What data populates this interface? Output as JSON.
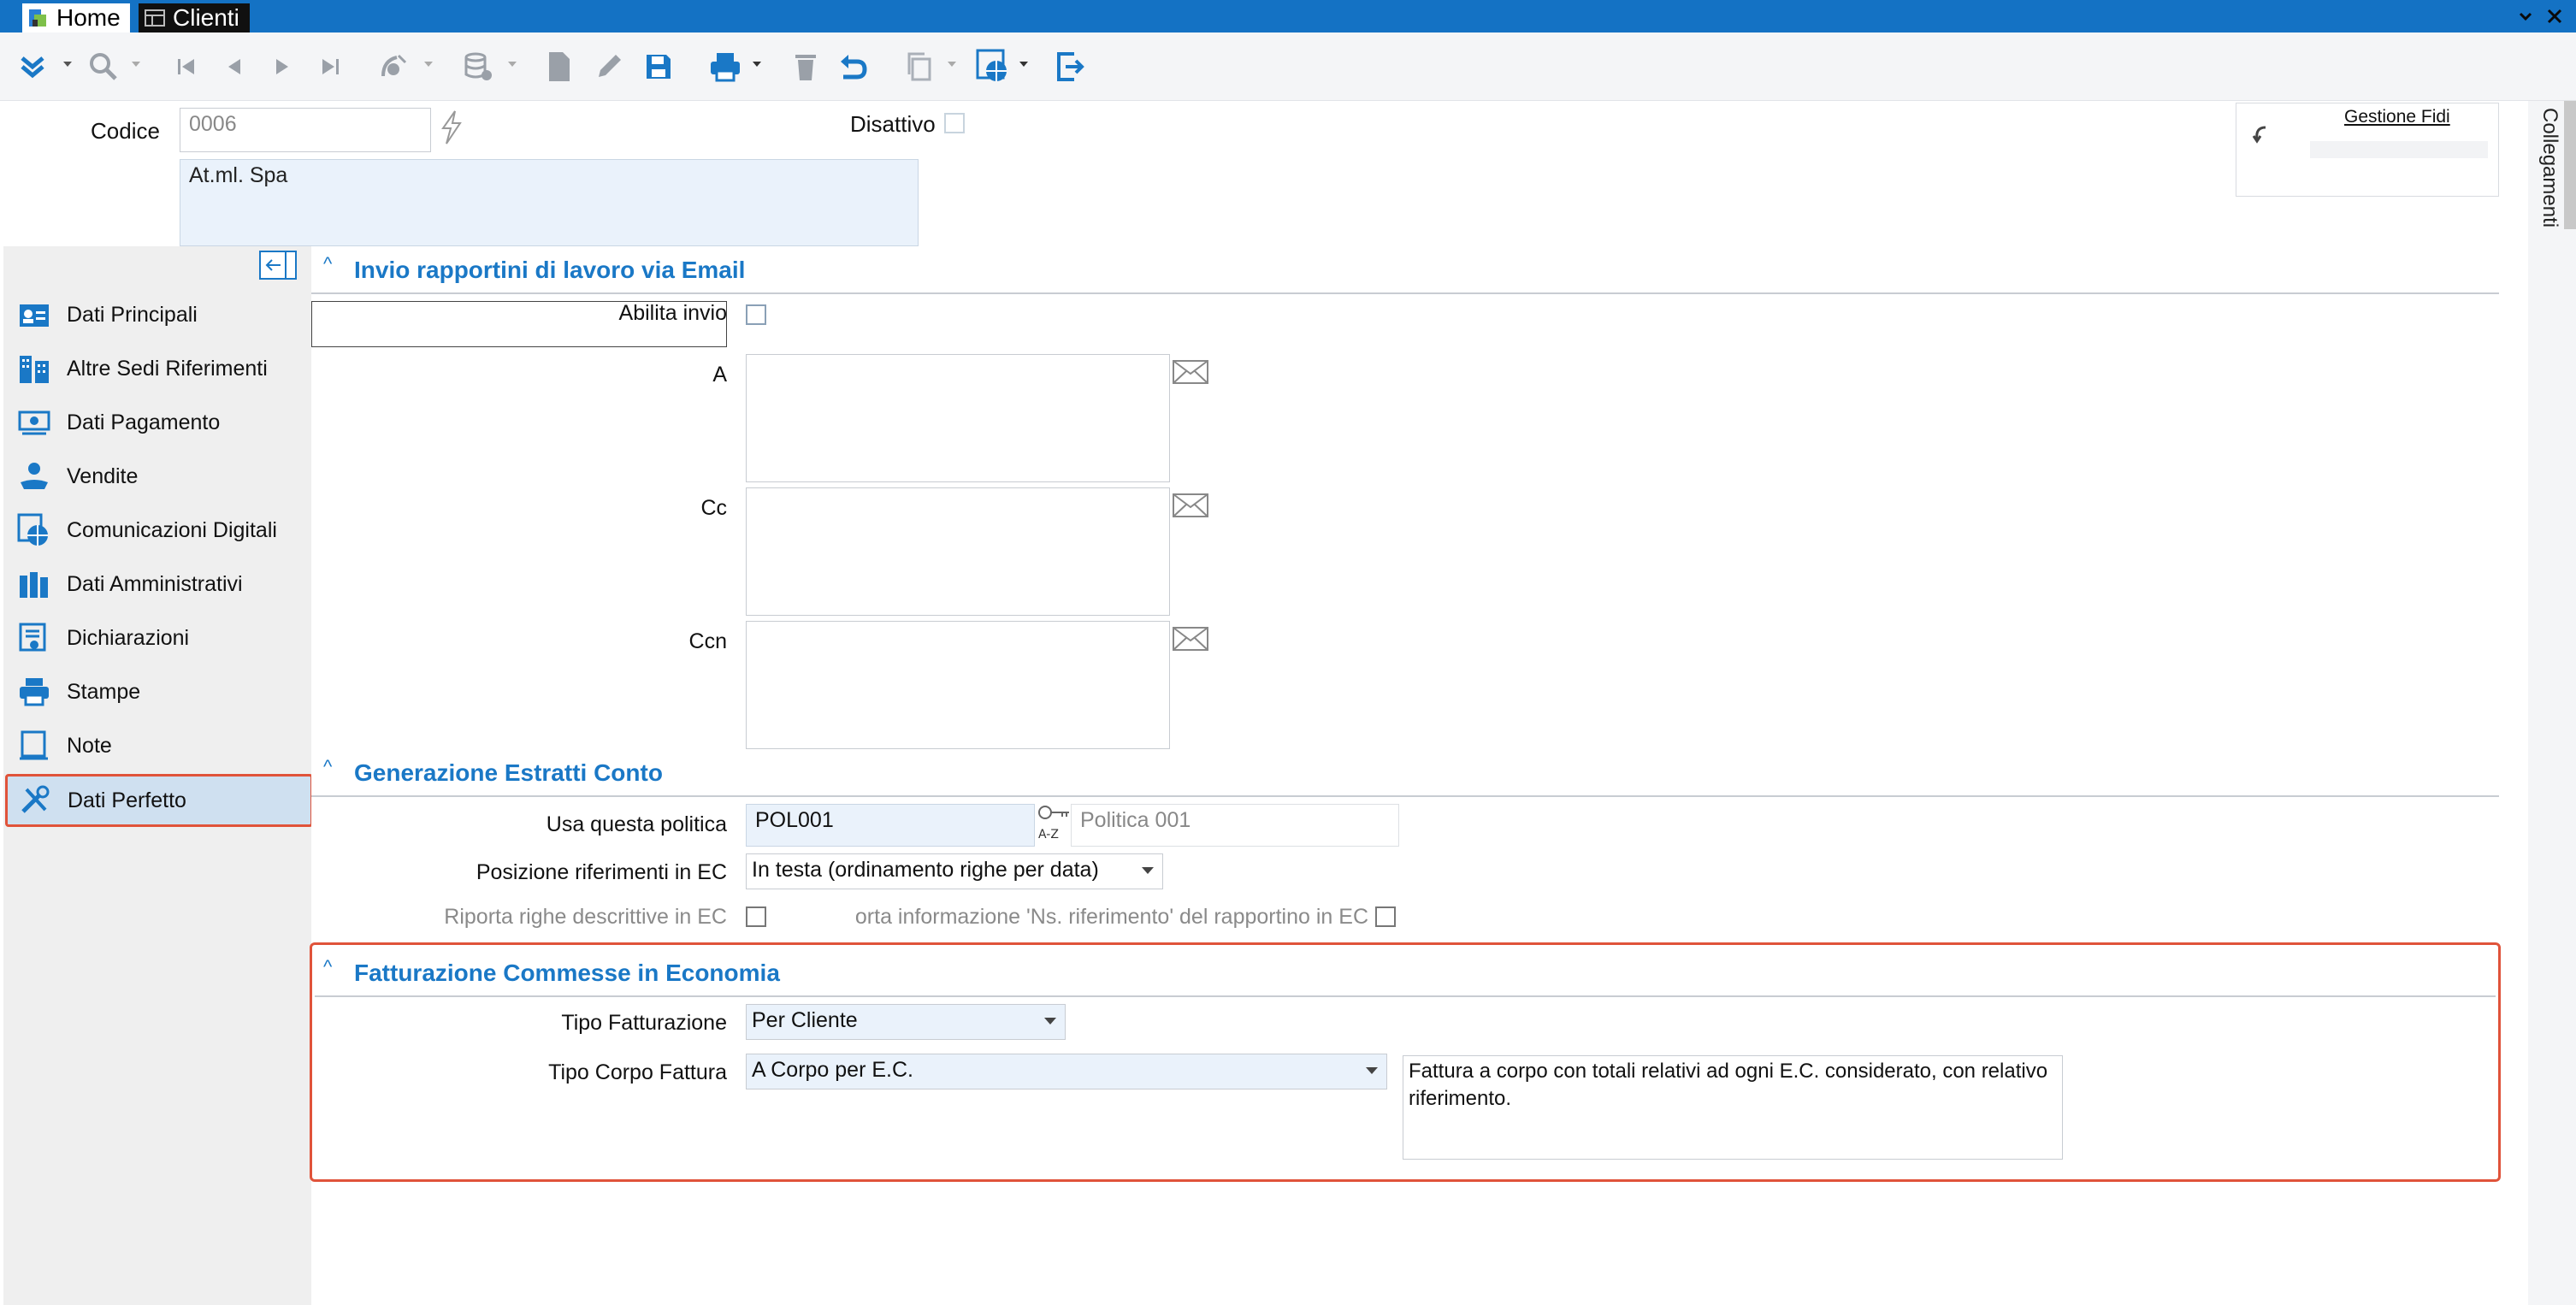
{
  "window": {
    "tabs": [
      {
        "label": "Home"
      },
      {
        "label": "Clienti"
      }
    ],
    "controls": [
      "minimize",
      "close"
    ]
  },
  "toolbar": {
    "icons": [
      "expand-chevrons-icon",
      "search-icon",
      "first-record-icon",
      "previous-record-icon",
      "next-record-icon",
      "last-record-icon",
      "satellite-icon",
      "database-icon",
      "new-document-icon",
      "edit-icon",
      "save-icon",
      "print-icon",
      "delete-icon",
      "undo-icon",
      "copy-icon",
      "web-icon",
      "exit-icon"
    ]
  },
  "header": {
    "codice_label": "Codice",
    "codice_value": "0006",
    "name_value": "At.ml. Spa",
    "disattivo_label": "Disattivo",
    "gestione_fidi_label": "Gestione Fidi",
    "collegamenti_label": "Collegamenti"
  },
  "sidebar": {
    "items": [
      {
        "label": "Dati Principali",
        "icon": "contact-card-icon"
      },
      {
        "label": "Altre Sedi Riferimenti",
        "icon": "building-icon"
      },
      {
        "label": "Dati Pagamento",
        "icon": "money-icon"
      },
      {
        "label": "Vendite",
        "icon": "sales-icon"
      },
      {
        "label": "Comunicazioni Digitali",
        "icon": "globe-document-icon"
      },
      {
        "label": "Dati Amministrativi",
        "icon": "binders-icon"
      },
      {
        "label": "Dichiarazioni",
        "icon": "certificate-icon"
      },
      {
        "label": "Stampe",
        "icon": "printer-icon"
      },
      {
        "label": "Note",
        "icon": "note-icon"
      },
      {
        "label": "Dati Perfetto",
        "icon": "tools-icon",
        "active": true
      }
    ]
  },
  "sections": {
    "email": {
      "title": "Invio rapportini di lavoro via Email",
      "abilita_label": "Abilita invio",
      "a_label": "A",
      "cc_label": "Cc",
      "ccn_label": "Ccn"
    },
    "estratti": {
      "title": "Generazione Estratti Conto",
      "politica_label": "Usa questa politica",
      "politica_code": "POL001",
      "politica_desc": "Politica 001",
      "posizione_label": "Posizione riferimenti in EC",
      "posizione_value": "In testa (ordinamento righe per data)",
      "riporta_label": "Riporta righe descrittive in EC",
      "riporta_info_label": "orta informazione 'Ns. riferimento' del rapportino in EC"
    },
    "fatturazione": {
      "title": "Fatturazione Commesse in Economia",
      "tipo_fatt_label": "Tipo Fatturazione",
      "tipo_fatt_value": "Per Cliente",
      "tipo_corpo_label": "Tipo Corpo Fattura",
      "tipo_corpo_value": "A Corpo per E.C.",
      "tipo_corpo_desc": "Fattura a corpo con totali relativi ad ogni E.C. considerato, con relativo riferimento."
    }
  },
  "colors": {
    "titlebar": "#1472c4",
    "section_title": "#1a78c6",
    "highlight": "#e0533a",
    "active_item": "#cfe0f0"
  }
}
